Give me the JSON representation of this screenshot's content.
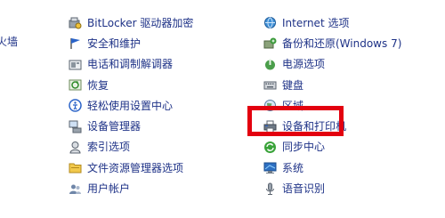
{
  "clipped_left_text": "火墙",
  "left_column": [
    {
      "name": "bitlocker",
      "label": "BitLocker 驱动器加密",
      "icon": "bitlocker-icon"
    },
    {
      "name": "security-maintenance",
      "label": "安全和维护",
      "icon": "flag-icon"
    },
    {
      "name": "phone-modem",
      "label": "电话和调制解调器",
      "icon": "phone-modem-icon"
    },
    {
      "name": "recovery",
      "label": "恢复",
      "icon": "recovery-icon"
    },
    {
      "name": "ease-of-access",
      "label": "轻松使用设置中心",
      "icon": "ease-of-access-icon"
    },
    {
      "name": "device-manager",
      "label": "设备管理器",
      "icon": "device-manager-icon"
    },
    {
      "name": "indexing-options",
      "label": "索引选项",
      "icon": "indexing-icon"
    },
    {
      "name": "file-explorer-options",
      "label": "文件资源管理器选项",
      "icon": "folder-options-icon"
    },
    {
      "name": "user-accounts",
      "label": "用户帐户",
      "icon": "user-accounts-icon"
    }
  ],
  "right_column": [
    {
      "name": "internet-options",
      "label": "Internet 选项",
      "icon": "internet-options-icon"
    },
    {
      "name": "backup-restore",
      "label": "备份和还原(Windows 7)",
      "icon": "backup-icon"
    },
    {
      "name": "power-options",
      "label": "电源选项",
      "icon": "power-icon"
    },
    {
      "name": "keyboard",
      "label": "键盘",
      "icon": "keyboard-icon"
    },
    {
      "name": "region",
      "label": "区域",
      "icon": "region-icon"
    },
    {
      "name": "devices-printers",
      "label": "设备和打印机",
      "icon": "printer-icon"
    },
    {
      "name": "sync-center",
      "label": "同步中心",
      "icon": "sync-icon"
    },
    {
      "name": "system",
      "label": "系统",
      "icon": "system-icon"
    },
    {
      "name": "speech-recognition",
      "label": "语音识别",
      "icon": "microphone-icon"
    }
  ],
  "highlight": {
    "target": "设备和打印机",
    "color": "#e3000f"
  }
}
